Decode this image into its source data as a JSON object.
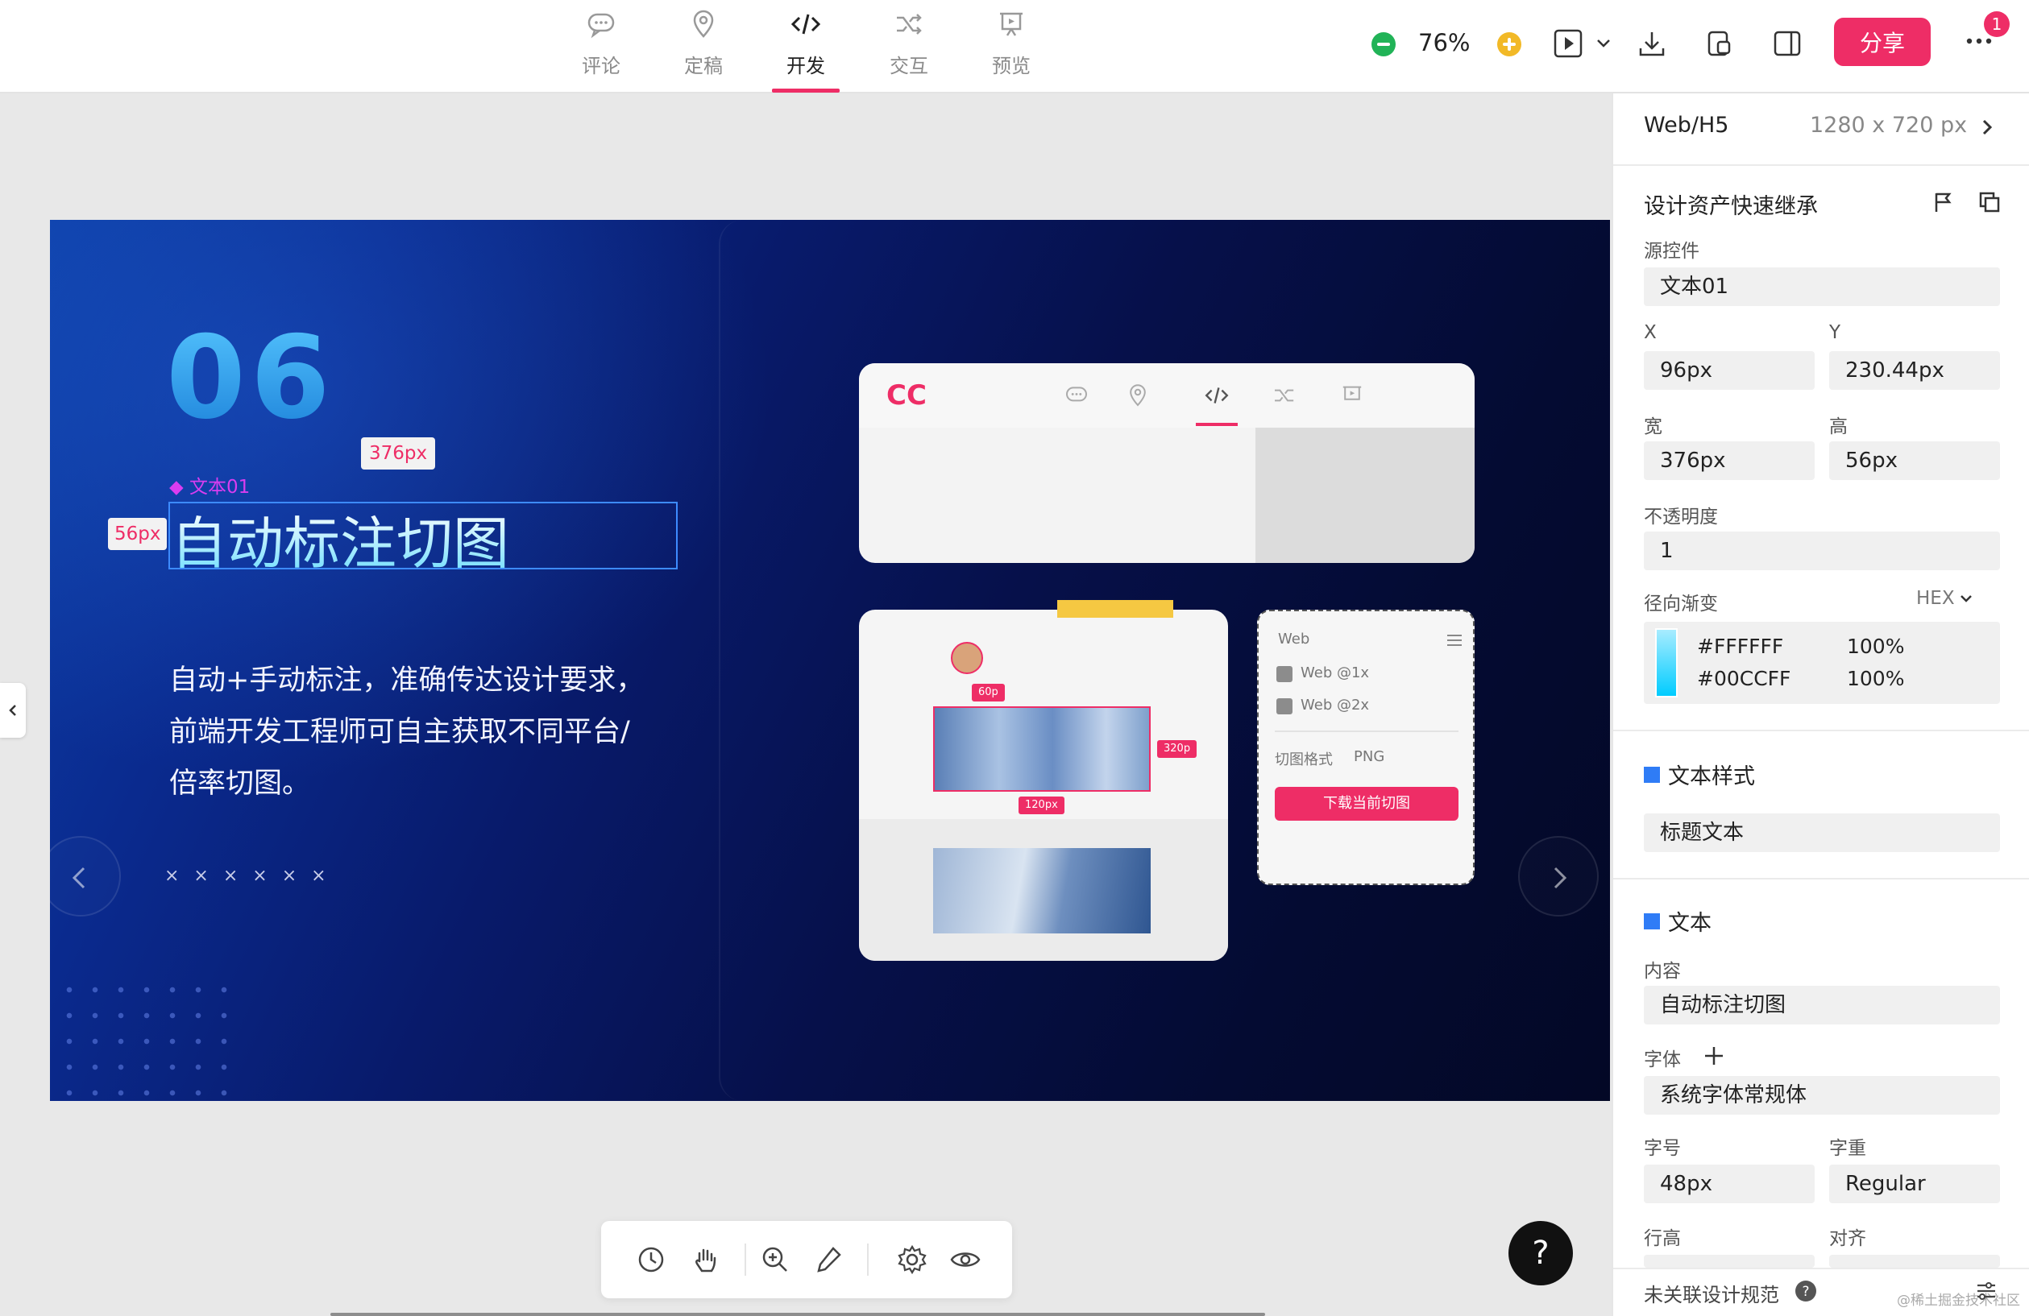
{
  "tabs": [
    {
      "label": "评论",
      "icon": "comment-icon"
    },
    {
      "label": "定稿",
      "icon": "location-pin-icon"
    },
    {
      "label": "开发",
      "icon": "code-icon",
      "active": true
    },
    {
      "label": "交互",
      "icon": "shuffle-icon"
    },
    {
      "label": "预览",
      "icon": "presentation-icon"
    }
  ],
  "toolbar": {
    "zoom": "76%",
    "share_label": "分享",
    "notification_count": "1",
    "accent": "#EE2D66"
  },
  "canvas": {
    "number": "06",
    "width_tag": "376px",
    "height_tag": "56px",
    "layer_label": "◆ 文本01",
    "heading": "自动标注切图",
    "body": "自动+手动标注，准确传达设计要求，前端开发工程师可自主获取不同平台/倍率切图。",
    "crosses": "××××××"
  },
  "mockup": {
    "logo": "CC",
    "tag_60": "60p",
    "tag_320": "320p",
    "tag_120": "120px",
    "export_platform": "Web",
    "export_1x": "Web @1x",
    "export_2x": "Web @2x",
    "format_label": "切图格式",
    "format_value": "PNG",
    "download_label": "下载当前切图"
  },
  "side_panel": {
    "platform": "Web/H5",
    "size": "1280 x 720 px",
    "inherit_title": "设计资产快速继承",
    "source_label": "源控件",
    "source_value": "文本01",
    "x_label": "X",
    "x_value": "96px",
    "y_label": "Y",
    "y_value": "230.44px",
    "w_label": "宽",
    "w_value": "376px",
    "h_label": "高",
    "h_value": "56px",
    "opacity_label": "不透明度",
    "opacity_value": "1",
    "gradient_label": "径向渐变",
    "gradient_format": "HEX",
    "gradient_stops": [
      {
        "color": "#FFFFFF",
        "opacity": "100%"
      },
      {
        "color": "#00CCFF",
        "opacity": "100%"
      }
    ],
    "text_style_title": "文本样式",
    "text_style_value": "标题文本",
    "text_title": "文本",
    "content_label": "内容",
    "content_value": "自动标注切图",
    "font_label": "字体",
    "font_value": "系统字体常规体",
    "size_label": "字号",
    "size_value": "48px",
    "weight_label": "字重",
    "weight_value": "Regular",
    "line_height_label": "行高",
    "align_label": "对齐",
    "footer_label": "未关联设计规范",
    "watermark": "@稀土掘金技术社区"
  }
}
